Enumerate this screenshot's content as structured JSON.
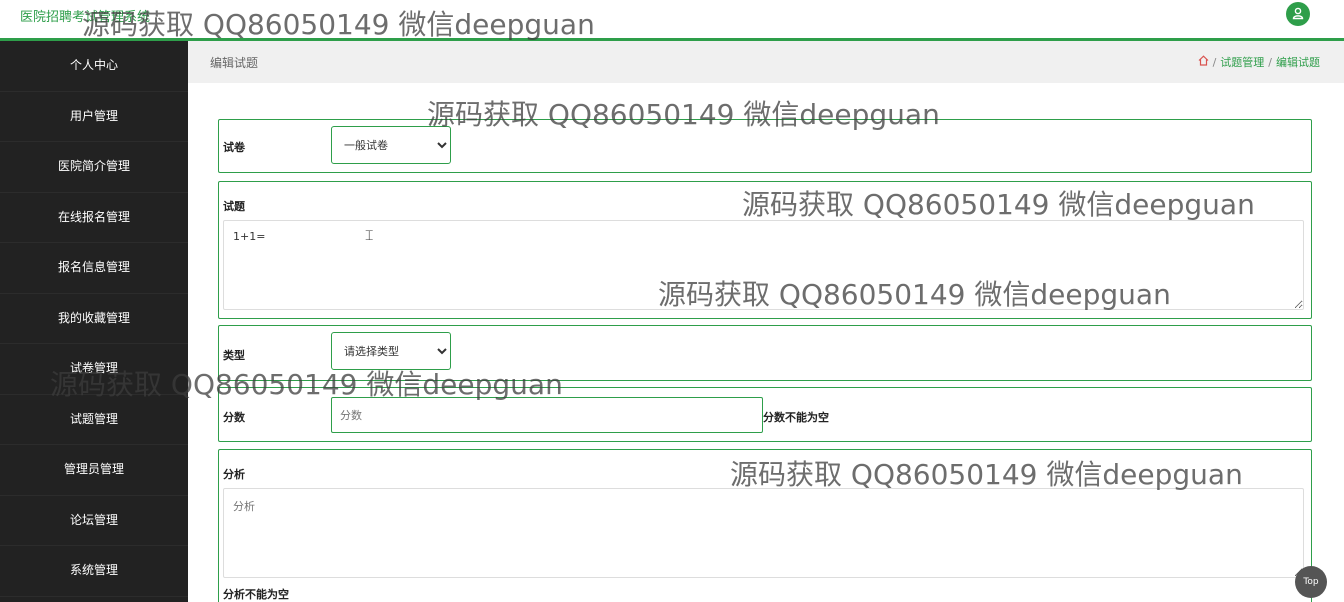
{
  "app": {
    "title": "医院招聘考试管理系统"
  },
  "sidebar": {
    "items": [
      {
        "label": "个人中心"
      },
      {
        "label": "用户管理"
      },
      {
        "label": "医院简介管理"
      },
      {
        "label": "在线报名管理"
      },
      {
        "label": "报名信息管理"
      },
      {
        "label": "我的收藏管理"
      },
      {
        "label": "试卷管理"
      },
      {
        "label": "试题管理"
      },
      {
        "label": "管理员管理"
      },
      {
        "label": "论坛管理"
      },
      {
        "label": "系统管理"
      }
    ]
  },
  "header": {
    "page_title": "编辑试题",
    "breadcrumb": [
      "试题管理",
      "编辑试题"
    ]
  },
  "form": {
    "paper": {
      "label": "试卷",
      "selected": "一般试卷"
    },
    "question": {
      "label": "试题",
      "value": "1+1="
    },
    "type": {
      "label": "类型",
      "selected": "请选择类型"
    },
    "score": {
      "label": "分数",
      "placeholder": "分数",
      "error": "分数不能为空"
    },
    "analysis": {
      "label": "分析",
      "placeholder": "分析",
      "error": "分析不能为空"
    }
  },
  "watermark": "源码获取 QQ86050149 微信deepguan",
  "top_button": "Top",
  "colors": {
    "accent": "#2e9e4a",
    "sidebar_bg": "#222222"
  }
}
